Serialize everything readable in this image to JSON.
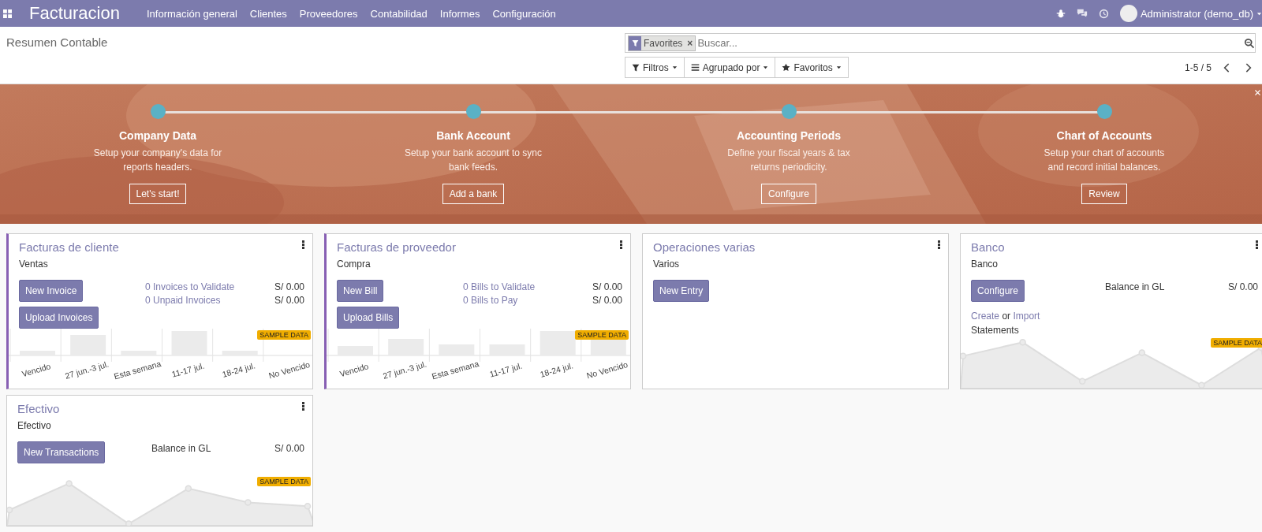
{
  "navbar": {
    "app_title": "Facturacion",
    "menu": [
      "Información general",
      "Clientes",
      "Proveedores",
      "Contabilidad",
      "Informes",
      "Configuración"
    ],
    "user": "Administrator (demo_db)"
  },
  "control_panel": {
    "breadcrumb": "Resumen Contable",
    "search": {
      "facet": "Favorites",
      "facet_remove": "×",
      "placeholder": "Buscar..."
    },
    "filters": [
      {
        "label": "Filtros"
      },
      {
        "label": "Agrupado por"
      },
      {
        "label": "Favoritos"
      }
    ],
    "pager": "1-5 / 5"
  },
  "onboarding": {
    "steps": [
      {
        "title": "Company Data",
        "description": "Setup your company's data for reports headers.",
        "button": "Let's start!"
      },
      {
        "title": "Bank Account",
        "description": "Setup your bank account to sync bank feeds.",
        "button": "Add a bank"
      },
      {
        "title": "Accounting Periods",
        "description": "Define your fiscal years & tax returns periodicity.",
        "button": "Configure"
      },
      {
        "title": "Chart of Accounts",
        "description": "Setup your chart of accounts and record initial balances.",
        "button": "Review"
      }
    ]
  },
  "journals": [
    {
      "title": "Facturas de cliente",
      "subtitle": "Ventas",
      "marked": true,
      "buttons": [
        "New Invoice",
        "Upload Invoices"
      ],
      "stats": [
        {
          "kind": "link",
          "label": "0 Invoices to Validate",
          "amount": "S/ 0.00"
        },
        {
          "kind": "link",
          "label": "0 Unpaid Invoices",
          "amount": "S/ 0.00"
        }
      ],
      "graph": {
        "kind": "bar",
        "badge": "SAMPLE DATA",
        "labels": [
          "Vencido",
          "27 jun.-3 jul.",
          "Esta semana",
          "11-17 jul.",
          "18-24 jul.",
          "No Vencido"
        ]
      }
    },
    {
      "title": "Facturas de proveedor",
      "subtitle": "Compra",
      "marked": true,
      "buttons": [
        "New Bill",
        "Upload Bills"
      ],
      "stats": [
        {
          "kind": "link",
          "label": "0 Bills to Validate",
          "amount": "S/ 0.00"
        },
        {
          "kind": "link",
          "label": "0 Bills to Pay",
          "amount": "S/ 0.00"
        }
      ],
      "graph": {
        "kind": "bar",
        "badge": "SAMPLE DATA",
        "labels": [
          "Vencido",
          "27 jun.-3 jul.",
          "Esta semana",
          "11-17 jul.",
          "18-24 jul.",
          "No Vencido"
        ]
      }
    },
    {
      "title": "Operaciones varias",
      "subtitle": "Varios",
      "marked": false,
      "buttons": [
        "New Entry"
      ]
    },
    {
      "title": "Banco",
      "subtitle": "Banco",
      "marked": false,
      "buttons": [
        "Configure"
      ],
      "stats": [
        {
          "kind": "plain",
          "label": "Balance in GL",
          "amount": "S/ 0.00"
        }
      ],
      "statement_links": {
        "create": "Create",
        "or": "or",
        "import": "Import",
        "tail": "Statements"
      },
      "graph": {
        "kind": "line",
        "badge": "SAMPLE DATA"
      }
    },
    {
      "title": "Efectivo",
      "subtitle": "Efectivo",
      "marked": false,
      "buttons": [
        "New Transactions"
      ],
      "stats": [
        {
          "kind": "plain",
          "label": "Balance in GL",
          "amount": "S/ 0.00"
        }
      ],
      "graph": {
        "kind": "line",
        "badge": "SAMPLE DATA"
      }
    }
  ]
}
